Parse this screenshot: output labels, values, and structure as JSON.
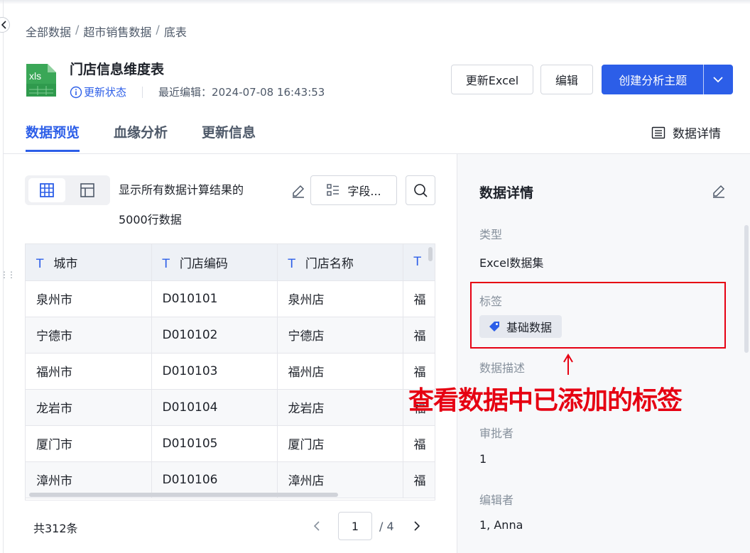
{
  "breadcrumb": {
    "items": [
      "全部数据",
      "超市销售数据",
      "底表"
    ],
    "separator": "/"
  },
  "header": {
    "title": "门店信息维度表",
    "file_type_icon": "xls",
    "status_link": "更新状态",
    "last_edit_label": "最近编辑：",
    "last_edit_time": "2024-07-08 16:43:53",
    "btn_update_excel": "更新Excel",
    "btn_edit": "编辑",
    "btn_create_topic": "创建分析主题"
  },
  "tabs": [
    "数据预览",
    "血缘分析",
    "更新信息"
  ],
  "detail_link": "数据详情",
  "toolbar": {
    "count_line1": "显示所有数据计算结果的",
    "count_line2": "5000行数据",
    "field_button": "字段..."
  },
  "table": {
    "columns": [
      "城市",
      "门店编码",
      "门店名称",
      ""
    ],
    "rows": [
      [
        "泉州市",
        "D010101",
        "泉州店",
        "福"
      ],
      [
        "宁德市",
        "D010102",
        "宁德店",
        "福"
      ],
      [
        "福州市",
        "D010103",
        "福州店",
        "福"
      ],
      [
        "龙岩市",
        "D010104",
        "龙岩店",
        "福"
      ],
      [
        "厦门市",
        "D010105",
        "厦门店",
        "福"
      ],
      [
        "漳州市",
        "D010106",
        "漳州店",
        "福"
      ]
    ]
  },
  "pagination": {
    "total": "共312条",
    "current_page": "1",
    "page_total": "/ 4"
  },
  "detail_panel": {
    "title": "数据详情",
    "type_label": "类型",
    "type_value": "Excel数据集",
    "tag_label": "标签",
    "tag_value": "基础数据",
    "desc_label": "数据描述",
    "approver_label": "审批者",
    "approver_value": "1",
    "editor_label": "编辑者",
    "editor_value": "1, Anna"
  },
  "annotation": {
    "text": "查看数据中已添加的标签",
    "color": "#e60012"
  },
  "colors": {
    "accent": "#2c5ee8",
    "annotation_red": "#e60012",
    "panel_bg": "#f7f8fa"
  }
}
